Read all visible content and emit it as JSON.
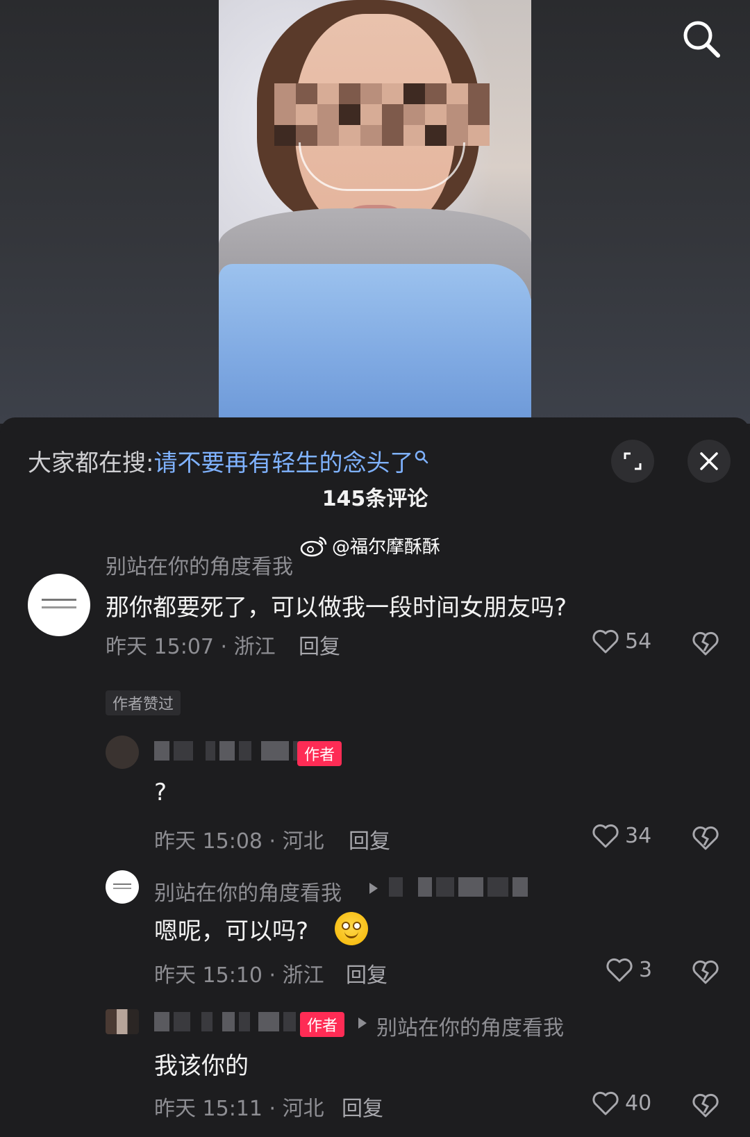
{
  "hot_search": {
    "prefix": "大家都在搜:",
    "query": "请不要再有轻生的念头了"
  },
  "comments_header": {
    "count_label": "145条评论"
  },
  "watermark": {
    "text": "@福尔摩酥酥"
  },
  "comments": [
    {
      "username": "别站在你的角度看我",
      "text": "那你都要死了，可以做我一段时间女朋友吗?",
      "time_location": "昨天 15:07 · 浙江",
      "reply_label": "回复",
      "likes": "54",
      "badge": "作者赞过"
    }
  ],
  "replies": [
    {
      "author_badge": "作者",
      "text": "?",
      "time_location": "昨天 15:08 · 河北",
      "reply_label": "回复",
      "likes": "34"
    },
    {
      "username": "别站在你的角度看我",
      "text": "嗯呢，可以吗?",
      "time_location": "昨天 15:10 · 浙江",
      "reply_label": "回复",
      "likes": "3"
    },
    {
      "author_badge": "作者",
      "reply_to": "别站在你的角度看我",
      "text": "我该你的",
      "time_location": "昨天 15:11 · 河北",
      "reply_label": "回复",
      "likes": "40"
    }
  ],
  "icons": {
    "search": "search-icon",
    "expand": "expand-icon",
    "close": "close-icon",
    "heart": "heart-icon",
    "broken_heart": "broken-heart-icon",
    "weibo": "weibo-icon"
  },
  "colors": {
    "accent_link": "#7fb2ff",
    "author_badge": "#fe2c55",
    "panel_bg": "#1d1d1f"
  }
}
